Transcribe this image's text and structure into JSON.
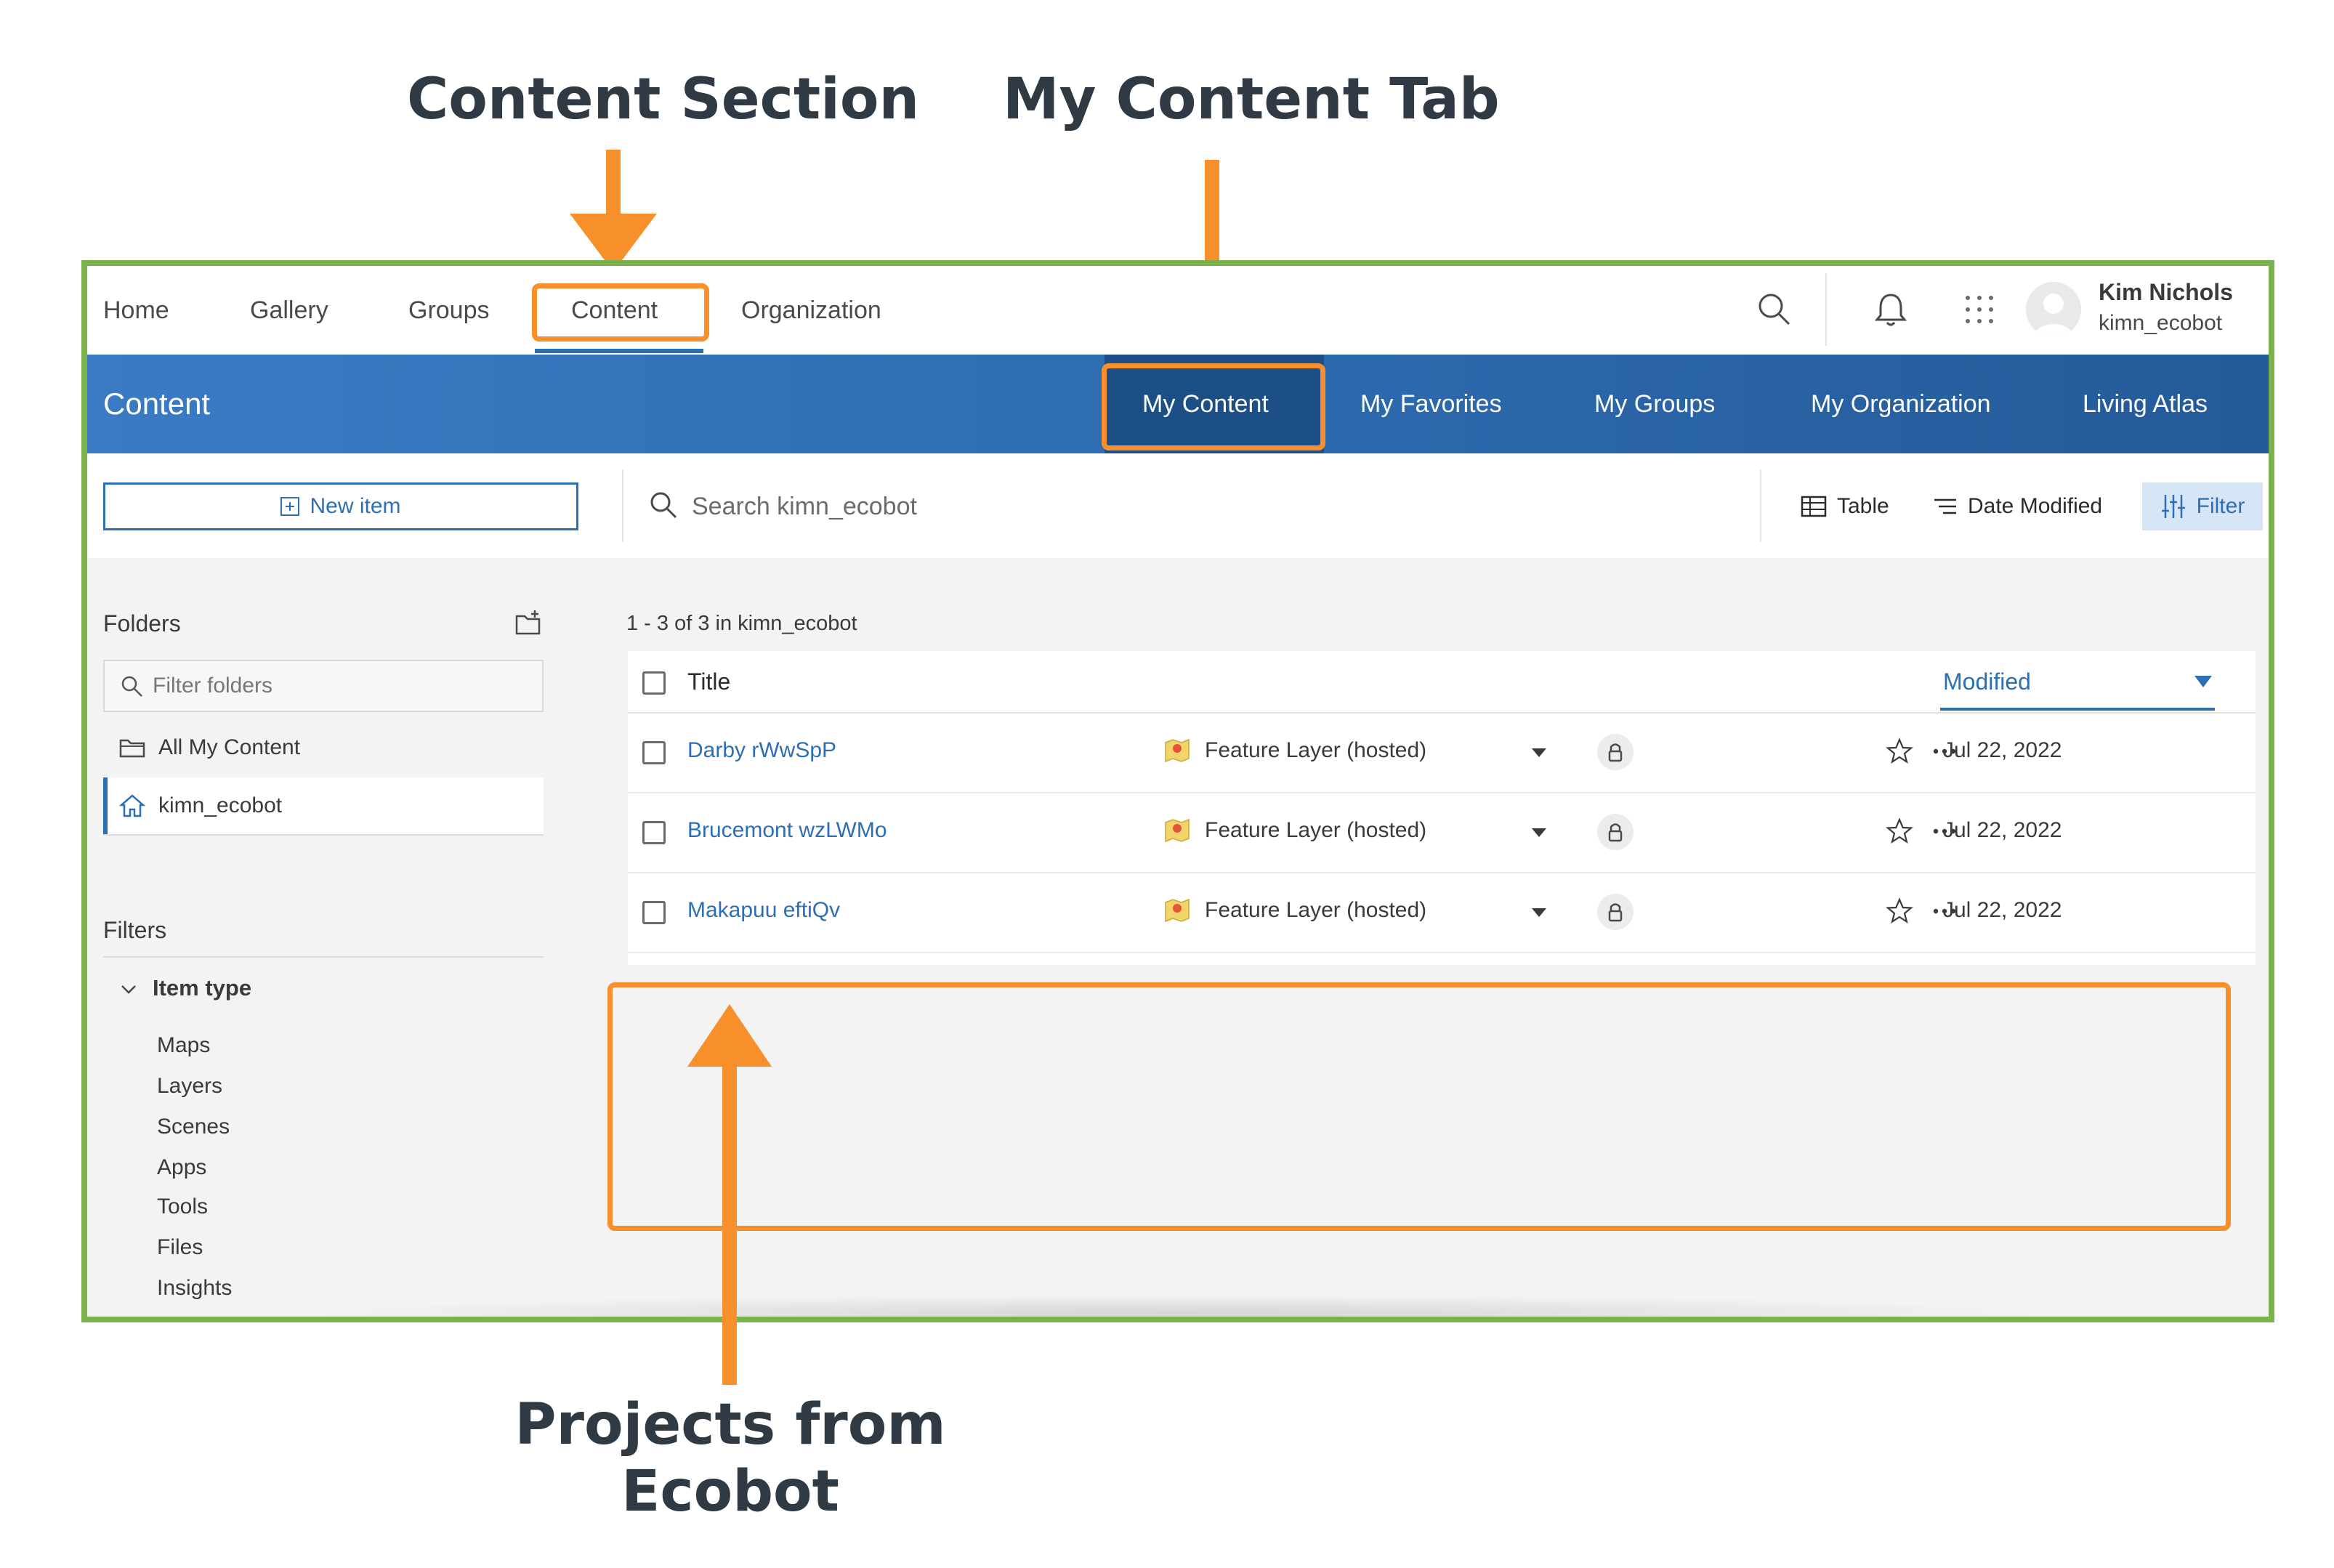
{
  "annotations": {
    "content_section": "Content Section",
    "my_content_tab": "My Content Tab",
    "projects_line1": "Projects from",
    "projects_line2": "Ecobot",
    "accent_color": "#f7902b",
    "frame_color": "#7cb24d"
  },
  "topnav": {
    "items": [
      "Home",
      "Gallery",
      "Groups",
      "Content",
      "Organization"
    ],
    "active": "Content",
    "user": {
      "name": "Kim Nichols",
      "handle": "kimn_ecobot"
    }
  },
  "header": {
    "title": "Content",
    "tabs": [
      "My Content",
      "My Favorites",
      "My Groups",
      "My Organization",
      "Living Atlas"
    ],
    "active_tab": "My Content"
  },
  "toolbar": {
    "new_item_label": "New item",
    "search_placeholder": "Search kimn_ecobot",
    "table_label": "Table",
    "sort_label": "Date Modified",
    "filter_label": "Filter"
  },
  "sidebar": {
    "folders_heading": "Folders",
    "filter_placeholder": "Filter folders",
    "folders": [
      "All My Content",
      "kimn_ecobot"
    ],
    "active_folder": "kimn_ecobot",
    "filters_heading": "Filters",
    "item_type_heading": "Item type",
    "item_types": [
      "Maps",
      "Layers",
      "Scenes",
      "Apps",
      "Tools",
      "Files",
      "Insights"
    ]
  },
  "results": {
    "count_text": "1 - 3 of 3 in kimn_ecobot",
    "columns": {
      "title": "Title",
      "modified": "Modified"
    },
    "rows": [
      {
        "title": "Darby rWwSpP",
        "type": "Feature Layer (hosted)",
        "modified": "Jul 22, 2022"
      },
      {
        "title": "Brucemont wzLWMo",
        "type": "Feature Layer (hosted)",
        "modified": "Jul 22, 2022"
      },
      {
        "title": "Makapuu eftiQv",
        "type": "Feature Layer (hosted)",
        "modified": "Jul 22, 2022"
      }
    ]
  }
}
